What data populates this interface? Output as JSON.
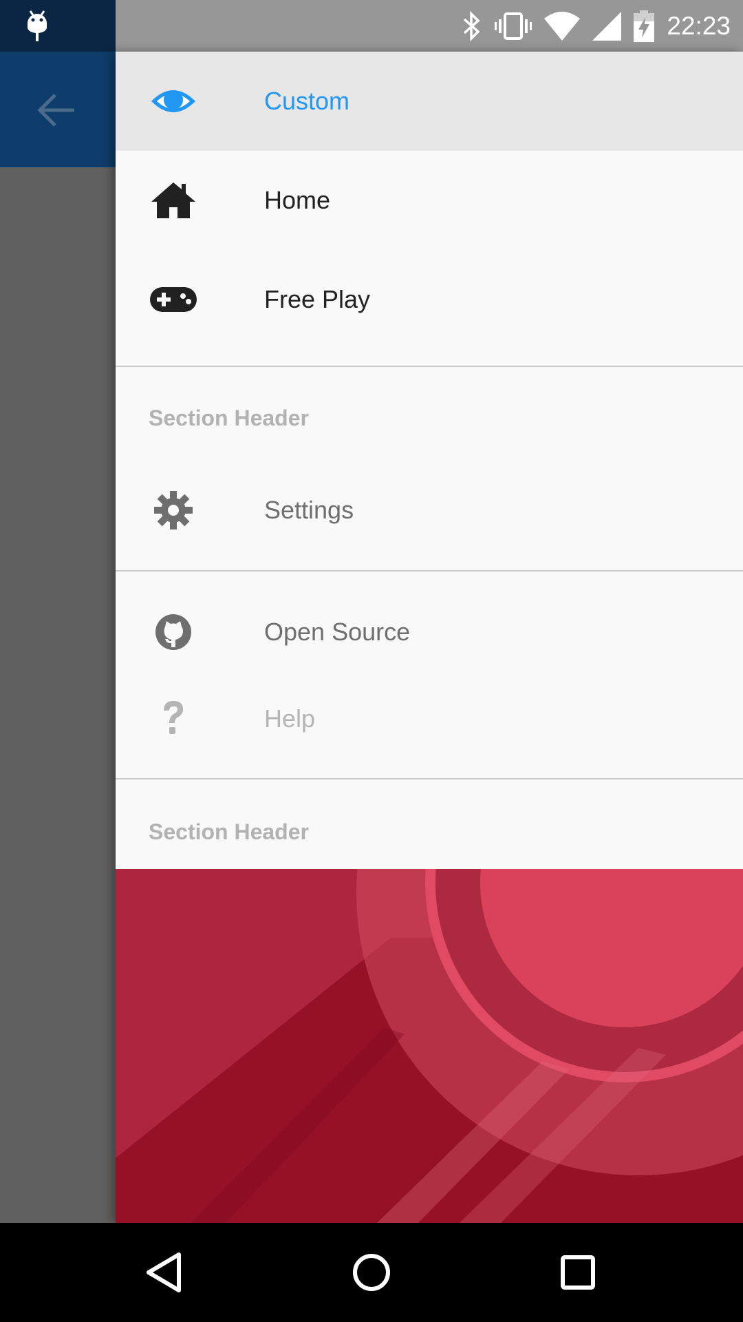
{
  "status_bar": {
    "time": "22:23",
    "icons": [
      "android-notification-icon",
      "bluetooth-icon",
      "vibrate-icon",
      "wifi-icon",
      "signal-icon",
      "battery-charging-icon"
    ]
  },
  "app_bar": {
    "back_icon": "arrow-back-icon",
    "color": "#0e3d6b"
  },
  "drawer": {
    "items": [
      {
        "label": "Custom",
        "icon": "eye-icon",
        "state": "selected"
      },
      {
        "label": "Home",
        "icon": "home-icon",
        "state": "normal"
      },
      {
        "label": "Free Play",
        "icon": "gamepad-icon",
        "state": "normal"
      },
      {
        "label": "Settings",
        "icon": "gear-icon",
        "state": "secondary"
      },
      {
        "label": "Open Source",
        "icon": "github-icon",
        "state": "secondary"
      },
      {
        "label": "Help",
        "icon": "help-icon",
        "state": "disabled"
      }
    ],
    "section_headers": [
      "Section Header",
      "Section Header"
    ],
    "accent_color": "#2196f3",
    "art_color": "#c0283f"
  },
  "nav_bar": {
    "buttons": [
      "back-triangle-icon",
      "home-circle-icon",
      "recents-square-icon"
    ]
  }
}
